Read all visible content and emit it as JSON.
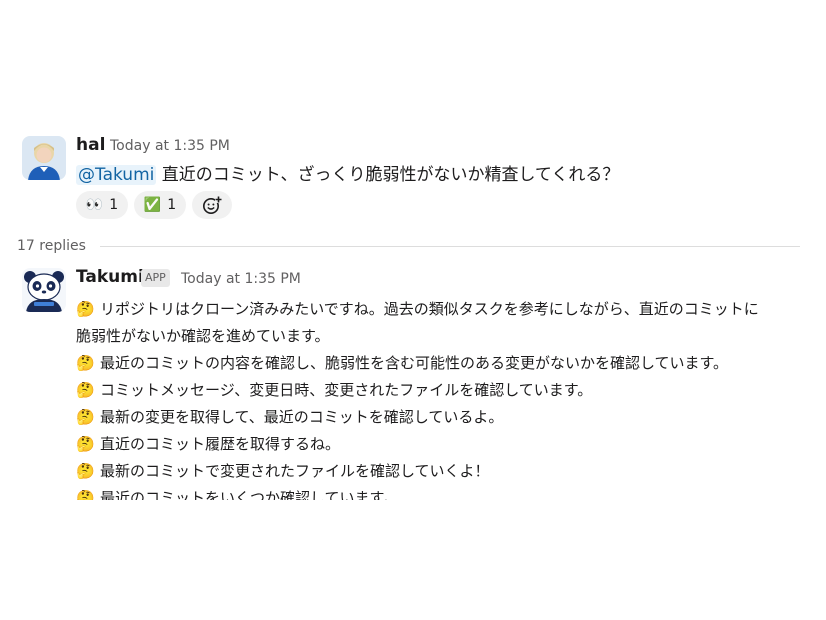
{
  "parent_message": {
    "author": "hal",
    "timestamp": "Today at 1:35 PM",
    "mention": "@Takumi",
    "text": " 直近のコミット、ざっくり脆弱性がないか精査してくれる？",
    "reactions": [
      {
        "emoji": "👀",
        "count": "1"
      },
      {
        "emoji": "✅",
        "count": "1"
      }
    ],
    "add_reaction_icon": "add-emoji-icon"
  },
  "thread": {
    "replies_label": "17 replies"
  },
  "reply": {
    "author": "Takumi",
    "badge": "APP",
    "timestamp": "Today at 1:35 PM",
    "emoji": "🤔",
    "lines": [
      "リポジトリはクローン済みみたいですね。過去の類似タスクを参考にしながら、直近のコミットに",
      "脆弱性がないか確認を進めています。",
      "最近のコミットの内容を確認し、脆弱性を含む可能性のある変更がないかを確認しています。",
      "コミットメッセージ、変更日時、変更されたファイルを確認しています。",
      "最新の変更を取得して、最近のコミットを確認しているよ。",
      "直近のコミット履歴を取得するね。",
      "最新のコミットで変更されたファイルを確認していくよ！",
      "最近のコミットをいくつか確認しています。"
    ]
  }
}
